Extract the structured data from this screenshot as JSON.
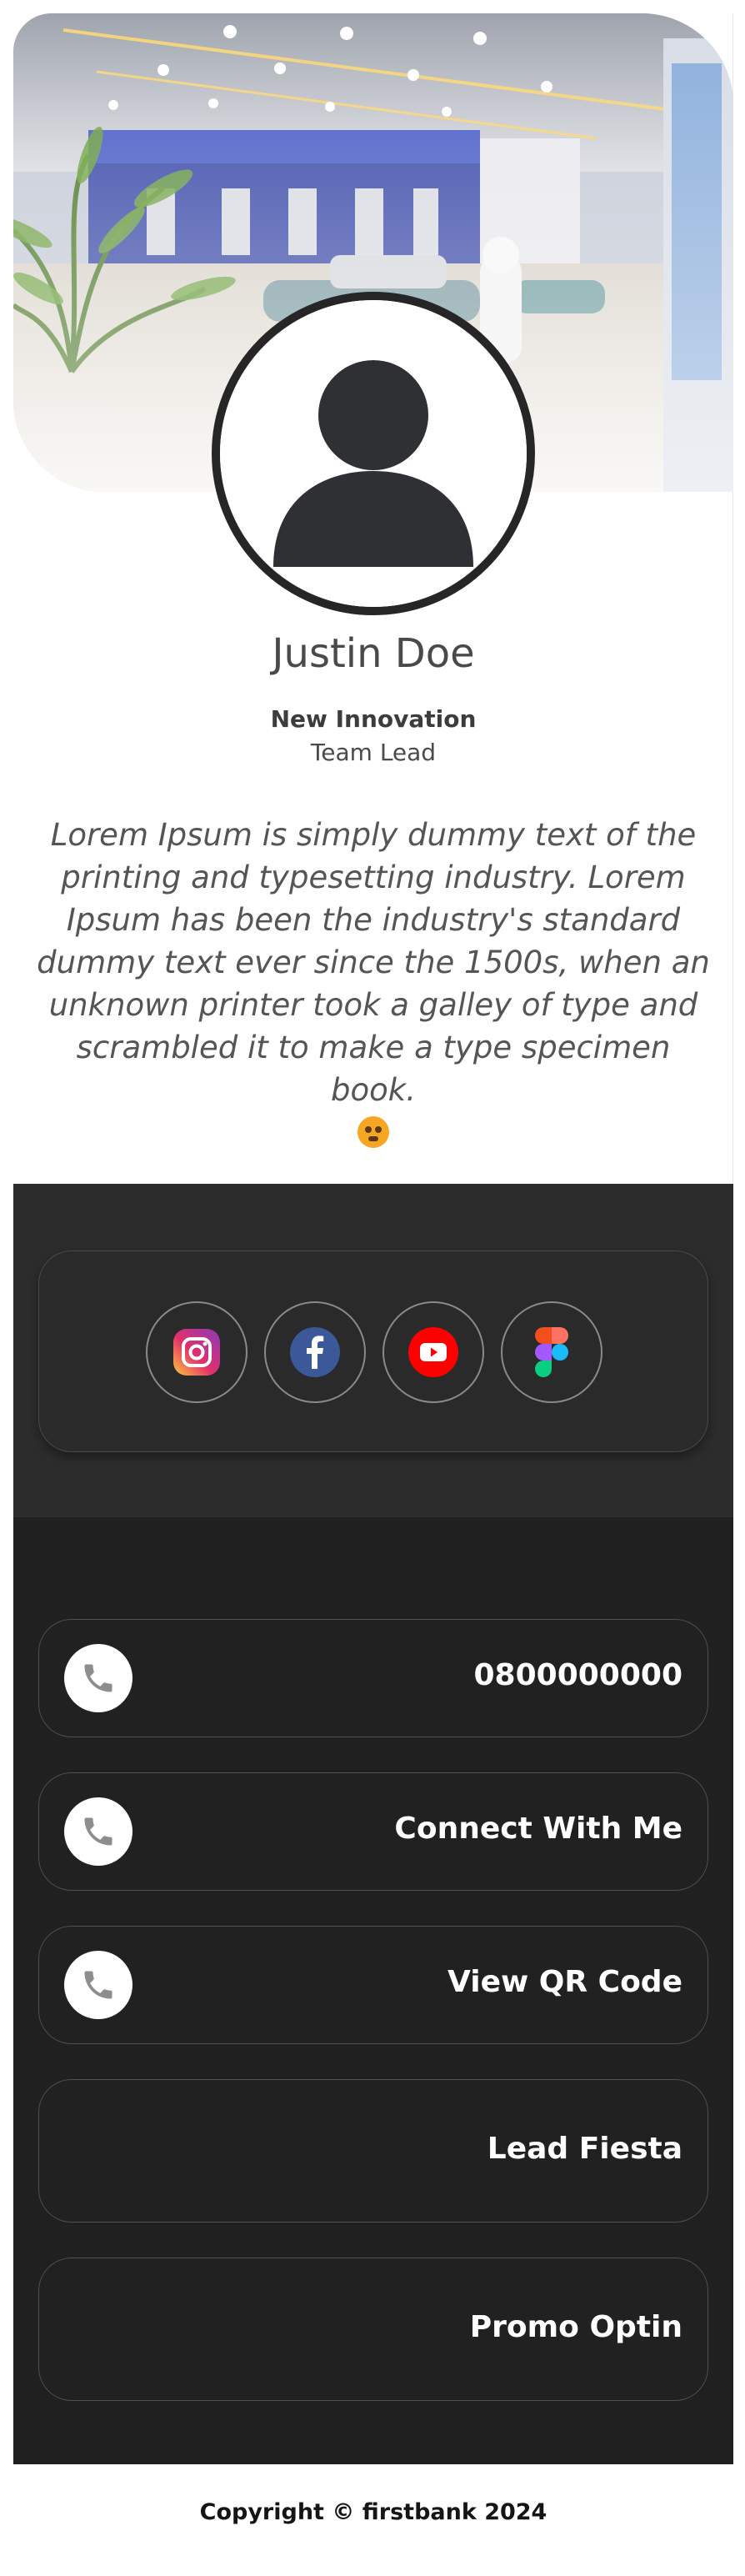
{
  "profile": {
    "name": "Justin Doe",
    "company": "New Innovation",
    "role": "Team Lead",
    "bio": "Lorem Ipsum is simply dummy text of the printing and typesetting industry. Lorem Ipsum has been the industry's standard dummy text ever since the 1500s, when an unknown printer took a galley of type and scrambled it to make a type specimen book."
  },
  "social": [
    {
      "name": "Instagram",
      "icon": "instagram-icon"
    },
    {
      "name": "Facebook",
      "icon": "facebook-icon"
    },
    {
      "name": "YouTube",
      "icon": "youtube-icon"
    },
    {
      "name": "Figma",
      "icon": "figma-icon"
    }
  ],
  "links": {
    "phone": "0800000000",
    "connect": "Connect With Me",
    "qr": "View QR Code",
    "lead": "Lead Fiesta",
    "promo": "Promo Optin"
  },
  "footer": {
    "text": "Copyright © firstbank 2024"
  },
  "colors": {
    "dark_panel": "#2c2c2c",
    "links_bg": "#202020",
    "instagram": "#e1306c",
    "facebook": "#3b5998",
    "youtube": "#ff0000"
  }
}
